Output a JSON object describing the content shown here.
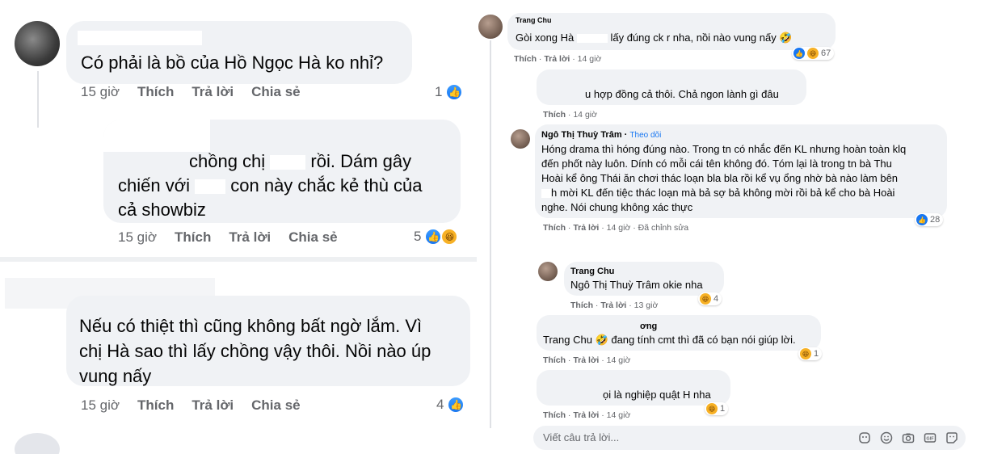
{
  "left": {
    "c1": {
      "text": "Có phải là bồ của Hồ Ngọc Hà ko nhỉ?",
      "time": "15 giờ",
      "like": "Thích",
      "reply": "Trả lời",
      "share": "Chia sẻ",
      "reactions": "1"
    },
    "c2": {
      "line1": "chồng chị ",
      "line1b": " rồi. Dám gây",
      "line2a": "chiến với ",
      "line2b": " con này chắc kẻ thù của",
      "line3": "cả showbiz",
      "time": "15 giờ",
      "like": "Thích",
      "reply": "Trả lời",
      "share": "Chia sẻ",
      "reactions": "5"
    },
    "c3": {
      "line1": "Nếu có thiệt thì cũng không bất ngờ lắm. Vì",
      "line2": "chị Hà sao thì lấy chồng vậy thôi. Nồi nào úp",
      "line3": "vung nấy",
      "time": "15 giờ",
      "like": "Thích",
      "reply": "Trả lời",
      "share": "Chia sẻ",
      "reactions": "4"
    }
  },
  "right": {
    "r1": {
      "name": "Trang Chu",
      "text_a": "Gòi xong Hà ",
      "text_b": " lấy đúng ck r nha, nồi nào vung nấy",
      "like": "Thích",
      "reply": "Trả lời",
      "time": "14 giờ",
      "reactions": "67"
    },
    "r2": {
      "text": "u hợp đồng cả thôi. Chả ngon lành gì đâu",
      "like": "Thích",
      "time": "14 giờ"
    },
    "r3": {
      "name": "Ngô Thị Thuỳ Trâm",
      "follow": "Theo dõi",
      "lines": [
        "Hóng drama thì hóng đúng nào. Trong tn có nhắc đến KL nhưng hoàn toàn klq",
        "đến phốt này luôn. Dính có mỗi cái tên không đó. Tóm lại là trong tn bà Thu",
        "Hoài kể ông Thái ăn chơi thác loạn bla bla rồi kể vụ ổng nhờ bà nào làm bên",
        "h mời KL đến tiệc thác loạn mà bả sợ bả không mời rồi bả kể cho bà Hoài",
        "nghe. Nói chung không xác thực"
      ],
      "like": "Thích",
      "reply": "Trả lời",
      "time": "14 giờ",
      "edited": "Đã chỉnh sửa",
      "reactions": "28"
    },
    "r4": {
      "name": "Trang Chu",
      "text": "Ngô Thị Thuỳ Trâm okie nha",
      "like": "Thích",
      "reply": "Trả lời",
      "time": "13 giờ",
      "reactions": "4"
    },
    "r5": {
      "name": "ơng",
      "text": "Trang Chu 🤣 đang tính cmt thì đã có bạn nói giúp lời.",
      "like": "Thích",
      "reply": "Trả lời",
      "time": "14 giờ",
      "reactions": "1"
    },
    "r6": {
      "text": "ọi là nghiệp quật H nha",
      "like": "Thích",
      "reply": "Trả lời",
      "time": "14 giờ",
      "reactions": "1"
    },
    "reply_box": {
      "placeholder": "Viết câu trả lời...",
      "icons": [
        "sticker-icon",
        "emoji-icon",
        "camera-icon",
        "gif-icon",
        "sticker-face-icon"
      ]
    }
  },
  "colors": {
    "bubble": "#f0f2f5",
    "meta": "#65676b",
    "like_blue": "#1877f2",
    "haha_yellow": "#f7b125"
  }
}
